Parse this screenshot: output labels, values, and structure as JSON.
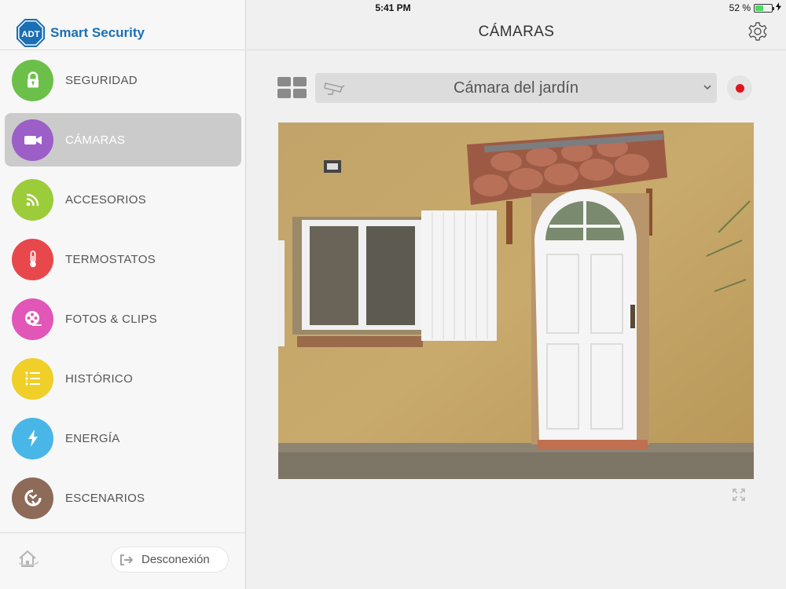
{
  "status_bar": {
    "device": "iPad",
    "time": "5:41 PM",
    "battery_text": "52 %",
    "battery_level": 0.52
  },
  "brand": {
    "logo_text": "ADT",
    "name": "Smart Security",
    "color": "#1a6fb5"
  },
  "nav": {
    "items": [
      {
        "label": "SEGURIDAD",
        "icon": "lock-icon",
        "color": "#6cc04a",
        "active": false
      },
      {
        "label": "CÁMARAS",
        "icon": "video-camera-icon",
        "color": "#9b5fc7",
        "active": true
      },
      {
        "label": "ACCESORIOS",
        "icon": "wireless-icon",
        "color": "#9ccc3a",
        "active": false
      },
      {
        "label": "TERMOSTATOS",
        "icon": "thermometer-icon",
        "color": "#e8484c",
        "active": false
      },
      {
        "label": "FOTOS & CLIPS",
        "icon": "film-reel-icon",
        "color": "#e256b8",
        "active": false
      },
      {
        "label": "HISTÓRICO",
        "icon": "list-icon",
        "color": "#efcf28",
        "active": false
      },
      {
        "label": "ENERGÍA",
        "icon": "lightning-icon",
        "color": "#48b6e6",
        "active": false
      },
      {
        "label": "ESCENARIOS",
        "icon": "scenes-icon",
        "color": "#8e6a58",
        "active": false
      }
    ]
  },
  "footer": {
    "logout_label": "Desconexión"
  },
  "header": {
    "title": "CÁMARAS"
  },
  "camera": {
    "selected": "Cámara del jardín",
    "record_color": "#e0141e"
  }
}
